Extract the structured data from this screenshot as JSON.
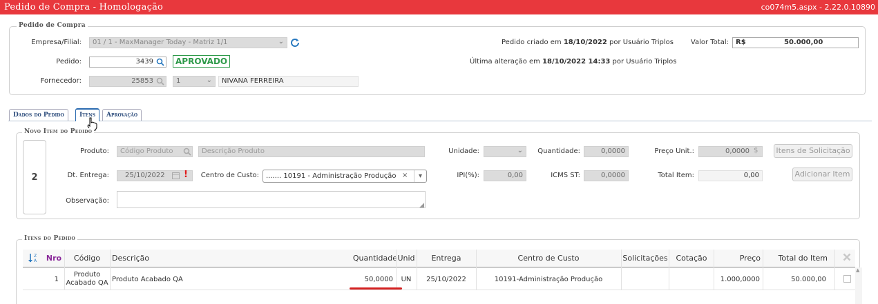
{
  "app": {
    "title": "Pedido de Compra  - Homologação",
    "version": "co074m5.aspx - 2.22.0.10890"
  },
  "pedido_compra": {
    "legend": "Pedido de Compra",
    "empresa_label": "Empresa/Filial:",
    "empresa_value": "01 / 1 - MaxManager Today - Matriz 1/1",
    "pedido_label": "Pedido:",
    "pedido_value": "3439",
    "status": "APROVADO",
    "fornecedor_label": "Fornecedor:",
    "fornecedor_code": "25853",
    "fornecedor_seq": "1",
    "fornecedor_name": "NIVANA FERREIRA",
    "criado_prefix": "Pedido criado em",
    "criado_date": "18/10/2022",
    "criado_suffix": "por Usuário Triplos",
    "alterado_prefix": "Última alteração em",
    "alterado_date": "18/10/2022 14:33",
    "alterado_suffix": "por Usuário Triplos",
    "valor_label": "Valor Total:",
    "valor_currency": "R$",
    "valor_value": "50.000,00"
  },
  "tabs": [
    {
      "label": "Dados do Pedido",
      "active": false
    },
    {
      "label": "Itens",
      "active": true
    },
    {
      "label": "Aprovação",
      "active": false
    }
  ],
  "novo_item": {
    "legend": "Novo Item do Pedido",
    "item_number": "2",
    "produto_label": "Produto:",
    "produto_code_placeholder": "Código Produto",
    "produto_desc_placeholder": "Descrição Produto",
    "unidade_label": "Unidade:",
    "quantidade_label": "Quantidade:",
    "quantidade_value": "0,0000",
    "preco_label": "Preço Unit.:",
    "preco_value": "0,0000",
    "preco_symbol": "$",
    "itens_solicitacao_button": "Itens de Solicitação",
    "entrega_label": "Dt. Entrega:",
    "entrega_value": "25/10/2022",
    "centro_label": "Centro de Custo:",
    "centro_value": "....... 10191 - Administração Produção",
    "ipi_label": "IPI(%):",
    "ipi_value": "0,00",
    "icms_label": "ICMS ST:",
    "icms_value": "0,0000",
    "total_item_label": "Total Item:",
    "total_item_value": "0,00",
    "adicionar_button": "Adicionar Item",
    "observacao_label": "Observação:"
  },
  "itens_pedido": {
    "legend": "Itens do Pedido",
    "columns": [
      "Nro",
      "Código",
      "Descrição",
      "Quantidade",
      "Unid",
      "Entrega",
      "Centro de Custo",
      "Solicitações",
      "Cotação",
      "Preço",
      "Total do Item"
    ],
    "rows": [
      {
        "nro": "1",
        "codigo_line1": "Produto",
        "codigo_line2": "Acabado QA",
        "descricao": "Produto Acabado QA",
        "quantidade": "50,0000",
        "unid": "UN",
        "entrega": "25/10/2022",
        "centro": "10191-Administração Produção",
        "solicitacoes": "",
        "cotacao": "",
        "preco": "1.000,0000",
        "total": "50.000,00"
      }
    ]
  },
  "colors": {
    "title_bar": "#e8383d",
    "approved": "#2e9a4a",
    "highlight_underline": "#d42020",
    "sync_icon": "#2a7ac0"
  }
}
